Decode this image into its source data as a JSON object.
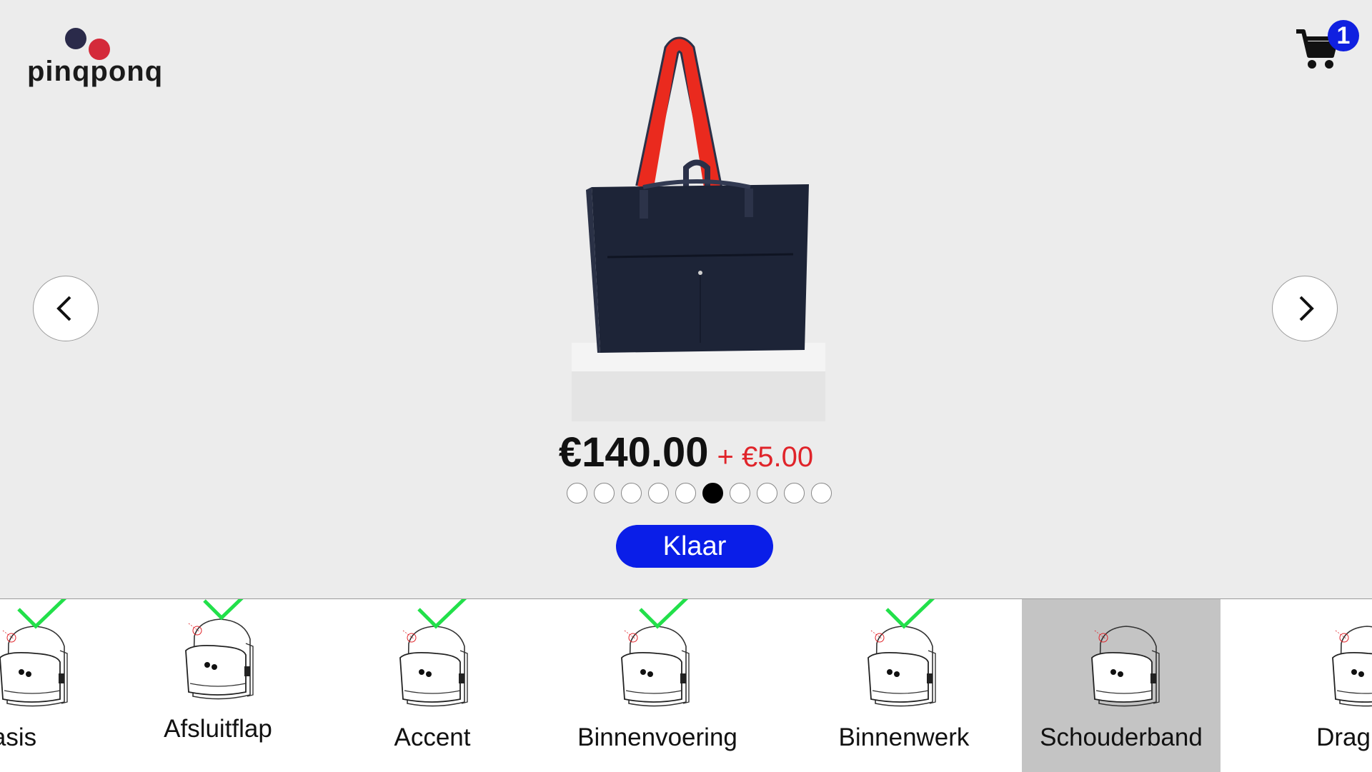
{
  "logo": {
    "text": "pinqponq"
  },
  "cart": {
    "count": "1"
  },
  "product": {
    "price": "€140.00",
    "surcharge": "+ €5.00"
  },
  "carousel": {
    "total_dots": 10,
    "active_index": 5
  },
  "actions": {
    "done_label": "Klaar"
  },
  "components": [
    {
      "label": "asis",
      "checked": true
    },
    {
      "label": "Afsluitflap",
      "checked": true
    },
    {
      "label": "Accent",
      "checked": true
    },
    {
      "label": "Binnenvoering",
      "checked": true
    },
    {
      "label": "Binnenwerk",
      "checked": true
    },
    {
      "label": "Schouderband",
      "checked": false,
      "selected": true
    },
    {
      "label": "Drag",
      "checked": false
    }
  ],
  "colors": {
    "accent": "#0a1ee8",
    "surcharge": "#e0242a",
    "check": "#22e04a",
    "selected_bg": "#c4c4c4"
  }
}
